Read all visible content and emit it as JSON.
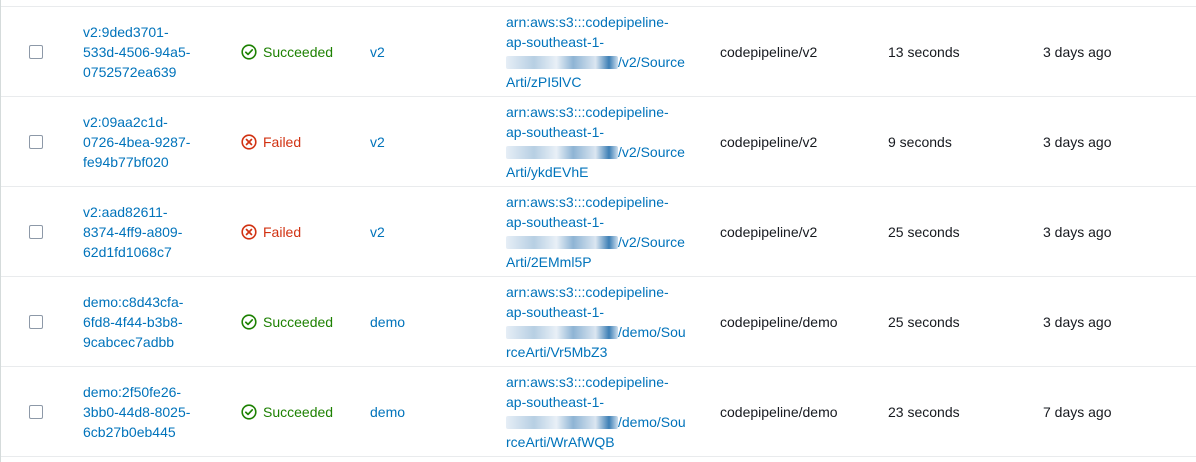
{
  "rows": [
    {
      "execution_id": "v2:9ded3701-\n533d-4506-94a5-\n0752572ea639",
      "status": "Succeeded",
      "status_type": "success",
      "pipeline": "v2",
      "artifact_line1": "arn:aws:s3:::codepipeline-",
      "artifact_line2": "ap-southeast-1-",
      "artifact_line3_suffix": "/v2/Source",
      "artifact_line4": "Arti/zPI5lVC",
      "directory": "codepipeline/v2",
      "duration": "13 seconds",
      "time": "3 days ago"
    },
    {
      "execution_id": "v2:09aa2c1d-\n0726-4bea-9287-\nfe94b77bf020",
      "status": "Failed",
      "status_type": "failed",
      "pipeline": "v2",
      "artifact_line1": "arn:aws:s3:::codepipeline-",
      "artifact_line2": "ap-southeast-1-",
      "artifact_line3_suffix": "/v2/Source",
      "artifact_line4": "Arti/ykdEVhE",
      "directory": "codepipeline/v2",
      "duration": "9 seconds",
      "time": "3 days ago"
    },
    {
      "execution_id": "v2:aad82611-\n8374-4ff9-a809-\n62d1fd1068c7",
      "status": "Failed",
      "status_type": "failed",
      "pipeline": "v2",
      "artifact_line1": "arn:aws:s3:::codepipeline-",
      "artifact_line2": "ap-southeast-1-",
      "artifact_line3_suffix": "/v2/Source",
      "artifact_line4": "Arti/2EMml5P",
      "directory": "codepipeline/v2",
      "duration": "25 seconds",
      "time": "3 days ago"
    },
    {
      "execution_id": "demo:c8d43cfa-\n6fd8-4f44-b3b8-\n9cabcec7adbb",
      "status": "Succeeded",
      "status_type": "success",
      "pipeline": "demo",
      "artifact_line1": "arn:aws:s3:::codepipeline-",
      "artifact_line2": "ap-southeast-1-",
      "artifact_line3_suffix": "/demo/Sou",
      "artifact_line4": "rceArti/Vr5MbZ3",
      "directory": "codepipeline/demo",
      "duration": "25 seconds",
      "time": "3 days ago"
    },
    {
      "execution_id": "demo:2f50fe26-\n3bb0-44d8-8025-\n6cb27b0eb445",
      "status": "Succeeded",
      "status_type": "success",
      "pipeline": "demo",
      "artifact_line1": "arn:aws:s3:::codepipeline-",
      "artifact_line2": "ap-southeast-1-",
      "artifact_line3_suffix": "/demo/Sou",
      "artifact_line4": "rceArti/WrAfWQB",
      "directory": "codepipeline/demo",
      "duration": "23 seconds",
      "time": "7 days ago"
    }
  ],
  "icons": {
    "success": "check-circle-icon",
    "failed": "x-circle-icon"
  },
  "colors": {
    "link": "#0073bb",
    "success": "#1d8102",
    "failed": "#d13212",
    "text": "#16191f"
  }
}
